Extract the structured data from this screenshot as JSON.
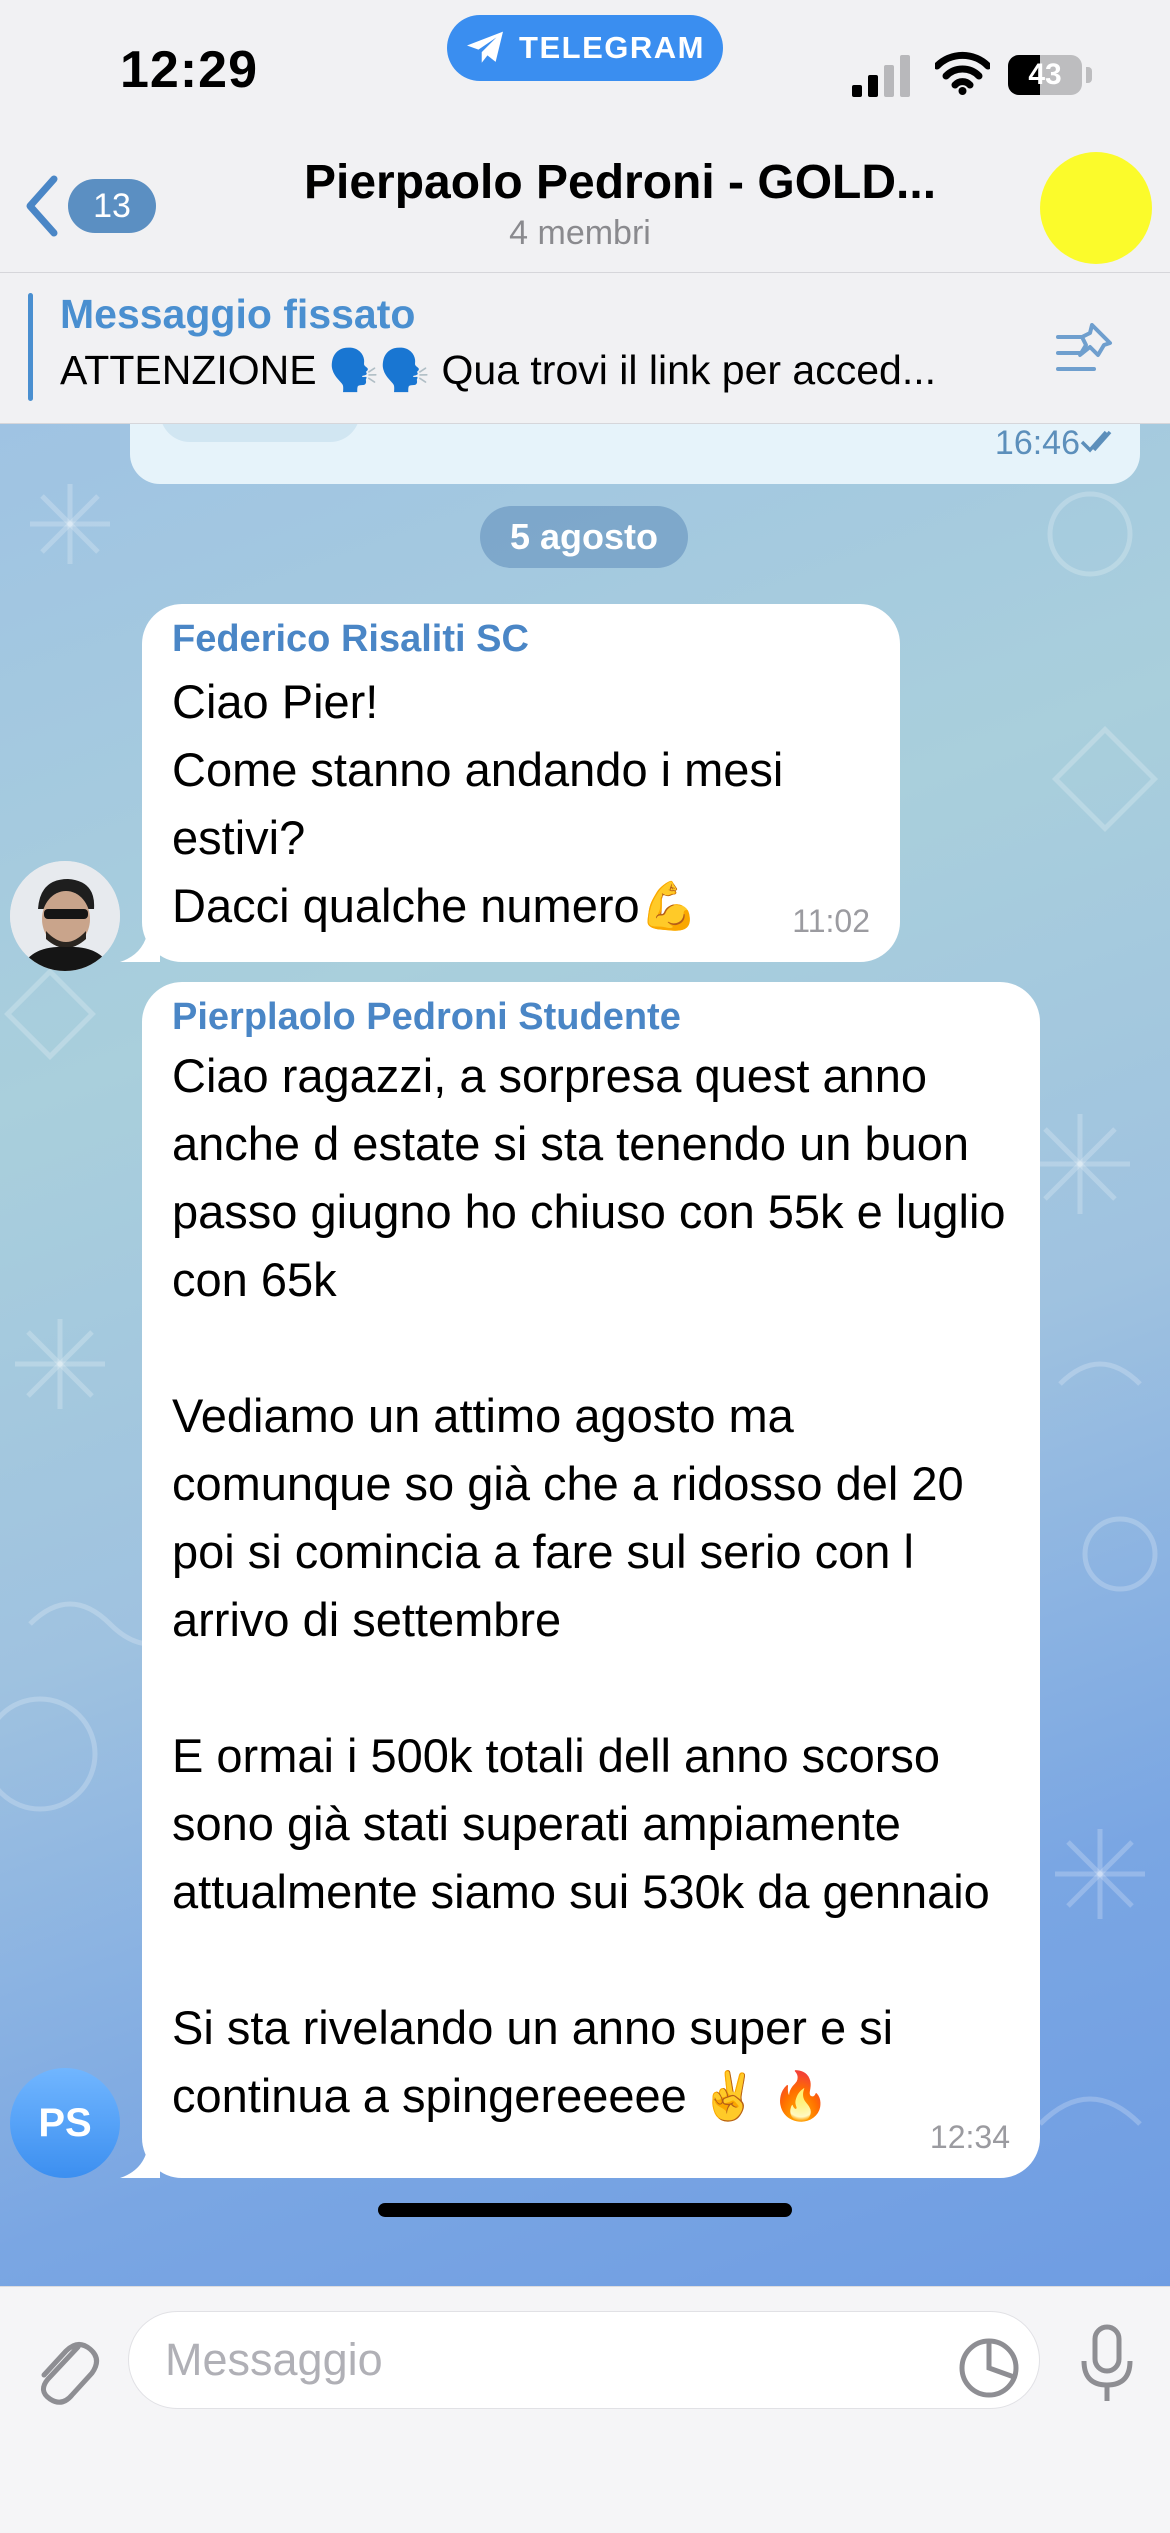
{
  "status_bar": {
    "time": "12:29",
    "return_app_label": "TELEGRAM",
    "battery_level": "43",
    "battery_fill_fraction": 0.43
  },
  "nav": {
    "back_badge": "13",
    "title": "Pierpaolo Pedroni - GOLD...",
    "subtitle": "4 membri",
    "avatar_color": "#fbfb2b"
  },
  "pinned": {
    "label": "Messaggio fissato",
    "text": "ATTENZIONE 🗣️🗣️ Qua trovi il link per acced..."
  },
  "chat": {
    "previous_message_time": "16:46",
    "date_separator": "5 agosto",
    "messages": [
      {
        "sender": "Federico Risaliti SC",
        "text": "Ciao Pier!\nCome stanno andando i mesi estivi?\nDacci qualche numero💪",
        "time": "11:02"
      },
      {
        "sender": "Pierplaolo Pedroni Studente",
        "avatar_initials": "PS",
        "text": "Ciao ragazzi, a sorpresa quest anno anche d estate si sta tenendo un buon passo giugno ho chiuso con 55k e luglio con 65k\n\nVediamo un attimo agosto ma comunque so già che a ridosso del 20 poi si comincia a fare sul serio con l arrivo di settembre\n\nE ormai i 500k totali dell anno scorso sono già stati superati ampiamente attualmente siamo sui 530k da gennaio\n\nSi sta rivelando un anno super e si continua a spingereeeee ✌️ 🔥",
        "time": "12:34"
      }
    ]
  },
  "composer": {
    "placeholder": "Messaggio"
  },
  "colors": {
    "accent": "#4a86c6",
    "telegram_pill": "#3a8ef0",
    "badge": "#5b8fc2"
  }
}
